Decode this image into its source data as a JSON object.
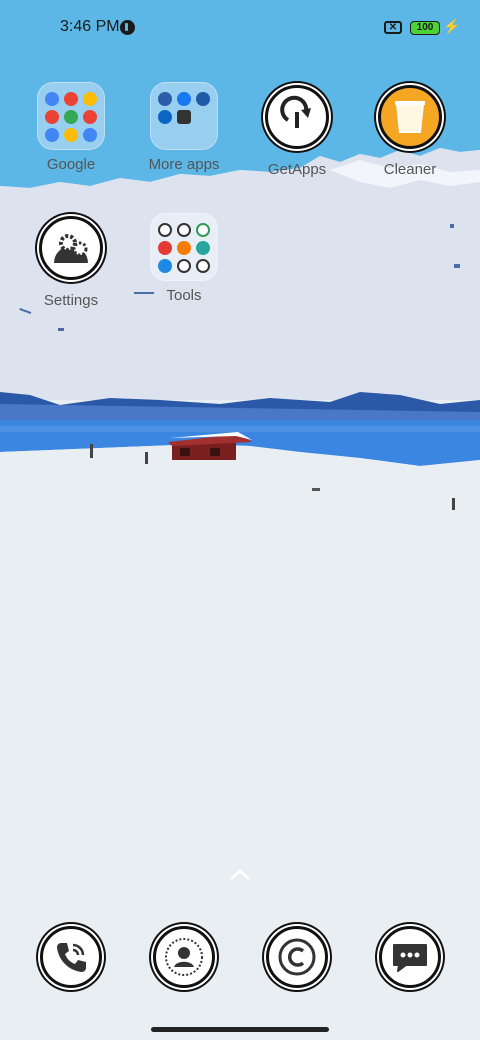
{
  "status_bar": {
    "time": "3:46 PM",
    "battery_level": "100",
    "icons": [
      "app-notification-icon",
      "no-sim-icon",
      "battery-icon",
      "charging-bolt-icon"
    ]
  },
  "home": {
    "apps": [
      {
        "label": "Google",
        "type": "folder"
      },
      {
        "label": "More apps",
        "type": "folder"
      },
      {
        "label": "GetApps",
        "icon": "download-arrow-icon"
      },
      {
        "label": "Cleaner",
        "icon": "trash-bin-icon"
      },
      {
        "label": "Settings",
        "icon": "gears-icon"
      },
      {
        "label": "Tools",
        "type": "folder"
      }
    ]
  },
  "dock": {
    "items": [
      "phone-icon",
      "contacts-icon",
      "copyright-app-icon",
      "messages-icon"
    ]
  },
  "colors": {
    "sky": "#5db7e6",
    "snow": "#e8eef2",
    "water": "#3a86e0",
    "cabin": "#8b2222",
    "cleaner_yellow": "#f5a623"
  }
}
